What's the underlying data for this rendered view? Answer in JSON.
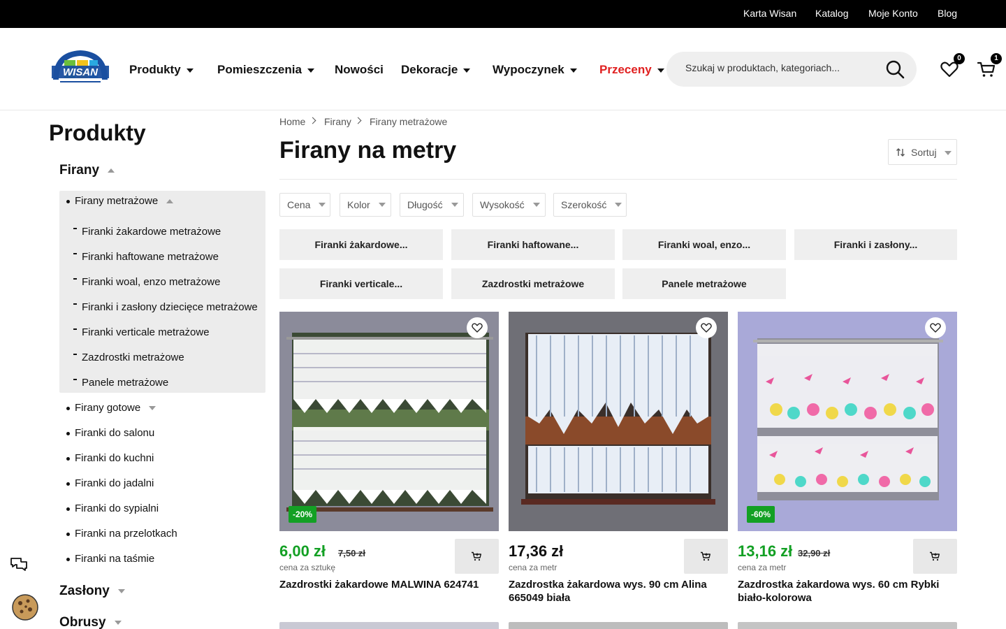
{
  "topbar": {
    "links": [
      "Karta Wisan",
      "Katalog",
      "Moje Konto",
      "Blog"
    ]
  },
  "header": {
    "logo_text": "WISAN",
    "nav": [
      {
        "label": "Produkty",
        "has_dropdown": true
      },
      {
        "label": "Pomieszczenia",
        "has_dropdown": true
      },
      {
        "label": "Nowości",
        "has_dropdown": false
      },
      {
        "label": "Dekoracje",
        "has_dropdown": true
      },
      {
        "label": "Wypoczynek",
        "has_dropdown": true
      },
      {
        "label": "Przeceny",
        "has_dropdown": true,
        "color": "#e02020"
      }
    ],
    "search_placeholder": "Szukaj w produktach, kategoriach...",
    "wishlist_count": "0",
    "cart_count": "1"
  },
  "sidebar": {
    "title": "Produkty",
    "categories": [
      {
        "label": "Firany",
        "expanded": true,
        "items": [
          {
            "label": "Firany metrażowe",
            "expanded": true,
            "subitems": [
              "Firanki żakardowe metrażowe",
              "Firanki haftowane metrażowe",
              "Firanki woal, enzo metrażowe",
              "Firanki i zasłony dziecięce metrażowe",
              "Firanki verticale metrażowe",
              "Zazdrostki metrażowe",
              "Panele metrażowe"
            ]
          },
          {
            "label": "Firany gotowe",
            "expanded": false
          },
          {
            "label": "Firanki do salonu"
          },
          {
            "label": "Firanki do kuchni"
          },
          {
            "label": "Firanki do jadalni"
          },
          {
            "label": "Firanki do sypialni"
          },
          {
            "label": "Firanki na przelotkach"
          },
          {
            "label": "Firanki na taśmie"
          }
        ]
      },
      {
        "label": "Zasłony",
        "expanded": false
      },
      {
        "label": "Obrusy",
        "expanded": false
      }
    ]
  },
  "breadcrumb": [
    "Home",
    "Firany",
    "Firany metrażowe"
  ],
  "page_title": "Firany na metry",
  "sort_label": "Sortuj",
  "filters": [
    "Cena",
    "Kolor",
    "Długość",
    "Wysokość",
    "Szerokość"
  ],
  "subcategories": [
    "Firanki żakardowe...",
    "Firanki haftowane...",
    "Firanki woal, enzo...",
    "Firanki i zasłony...",
    "Firanki verticale...",
    "Zazdrostki metrażowe",
    "Panele metrażowe"
  ],
  "products": [
    {
      "price": "6,00 zł",
      "old_price": "7,50 zł",
      "unit": "cena za sztukę",
      "name": "Zazdrostki żakardowe MALWINA 624741",
      "discount": "-20%"
    },
    {
      "price": "17,36 zł",
      "old_price": "",
      "unit": "cena za metr",
      "name": "Zazdrostka żakardowa wys. 90 cm Alina 665049 biała",
      "discount": ""
    },
    {
      "price": "13,16 zł",
      "old_price": "32,90 zł",
      "unit": "cena za metr",
      "name": "Zazdrostka żakardowa wys. 60 cm Rybki biało-kolorowa",
      "discount": "-60%"
    }
  ],
  "colors": {
    "sale_green": "#13a024",
    "accent_red": "#e02020",
    "topbar_bg": "#000000"
  }
}
